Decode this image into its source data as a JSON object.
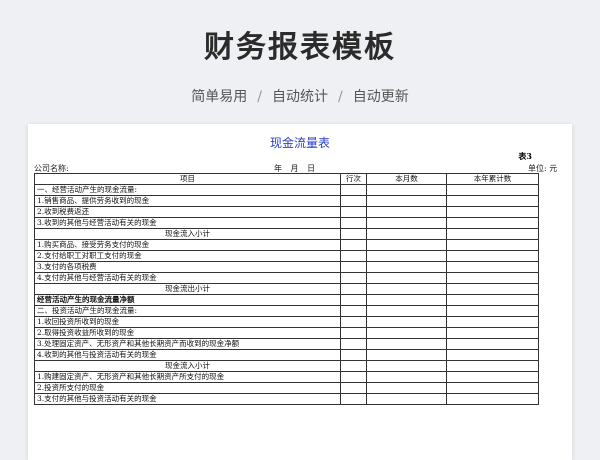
{
  "banner": {
    "title": "财务报表模板",
    "features": [
      "简单易用",
      "自动统计",
      "自动更新"
    ],
    "separator": "/"
  },
  "sheet": {
    "title": "现金流量表",
    "table_id": "表3",
    "company_label": "公司名称:",
    "date_label": "年 月 日",
    "unit_label": "单位: 元",
    "columns": [
      "项目",
      "行次",
      "本月数",
      "本年累计数"
    ],
    "rows": [
      {
        "text": "一、经营活动产生的现金流量:",
        "align": "left",
        "bold": false
      },
      {
        "text": "1.销售商品、提供劳务收到的现金",
        "align": "left",
        "bold": false
      },
      {
        "text": "2.收到税费返还",
        "align": "left",
        "bold": false
      },
      {
        "text": "3.收到的其他与经营活动有关的现金",
        "align": "left",
        "bold": false
      },
      {
        "text": "现金流入小计",
        "align": "center",
        "bold": false
      },
      {
        "text": "1.购买商品、接受劳务支付的现金",
        "align": "left",
        "bold": false
      },
      {
        "text": "2.支付给职工对职工支付的现金",
        "align": "left",
        "bold": false
      },
      {
        "text": "3.支付的各项税费",
        "align": "left",
        "bold": false
      },
      {
        "text": "4.支付的其他与经营活动有关的现金",
        "align": "left",
        "bold": false
      },
      {
        "text": "现金流出小计",
        "align": "center",
        "bold": false
      },
      {
        "text": "经营活动产生的现金流量净额",
        "align": "left",
        "bold": true
      },
      {
        "text": "二、投资活动产生的现金流量:",
        "align": "left",
        "bold": false
      },
      {
        "text": "1.收回投资所收到的现金",
        "align": "left",
        "bold": false
      },
      {
        "text": "2.取得投资收益所收到的现金",
        "align": "left",
        "bold": false
      },
      {
        "text": "3.处理固定资产、无形资产和其他长期资产而收到的现金净额",
        "align": "left",
        "bold": false
      },
      {
        "text": "4.收到的其他与投资活动有关的现金",
        "align": "left",
        "bold": false
      },
      {
        "text": "现金流入小计",
        "align": "center",
        "bold": false
      },
      {
        "text": "1.购建固定资产、无形资产和其他长期资产所支付的现金",
        "align": "left",
        "bold": false
      },
      {
        "text": "2.投资所支付的现金",
        "align": "left",
        "bold": false
      },
      {
        "text": "3.支付的其他与投资活动有关的现金",
        "align": "left",
        "bold": false
      }
    ]
  },
  "colors": {
    "title_blue": "#2a3fc2",
    "background": "#eef0f3"
  }
}
